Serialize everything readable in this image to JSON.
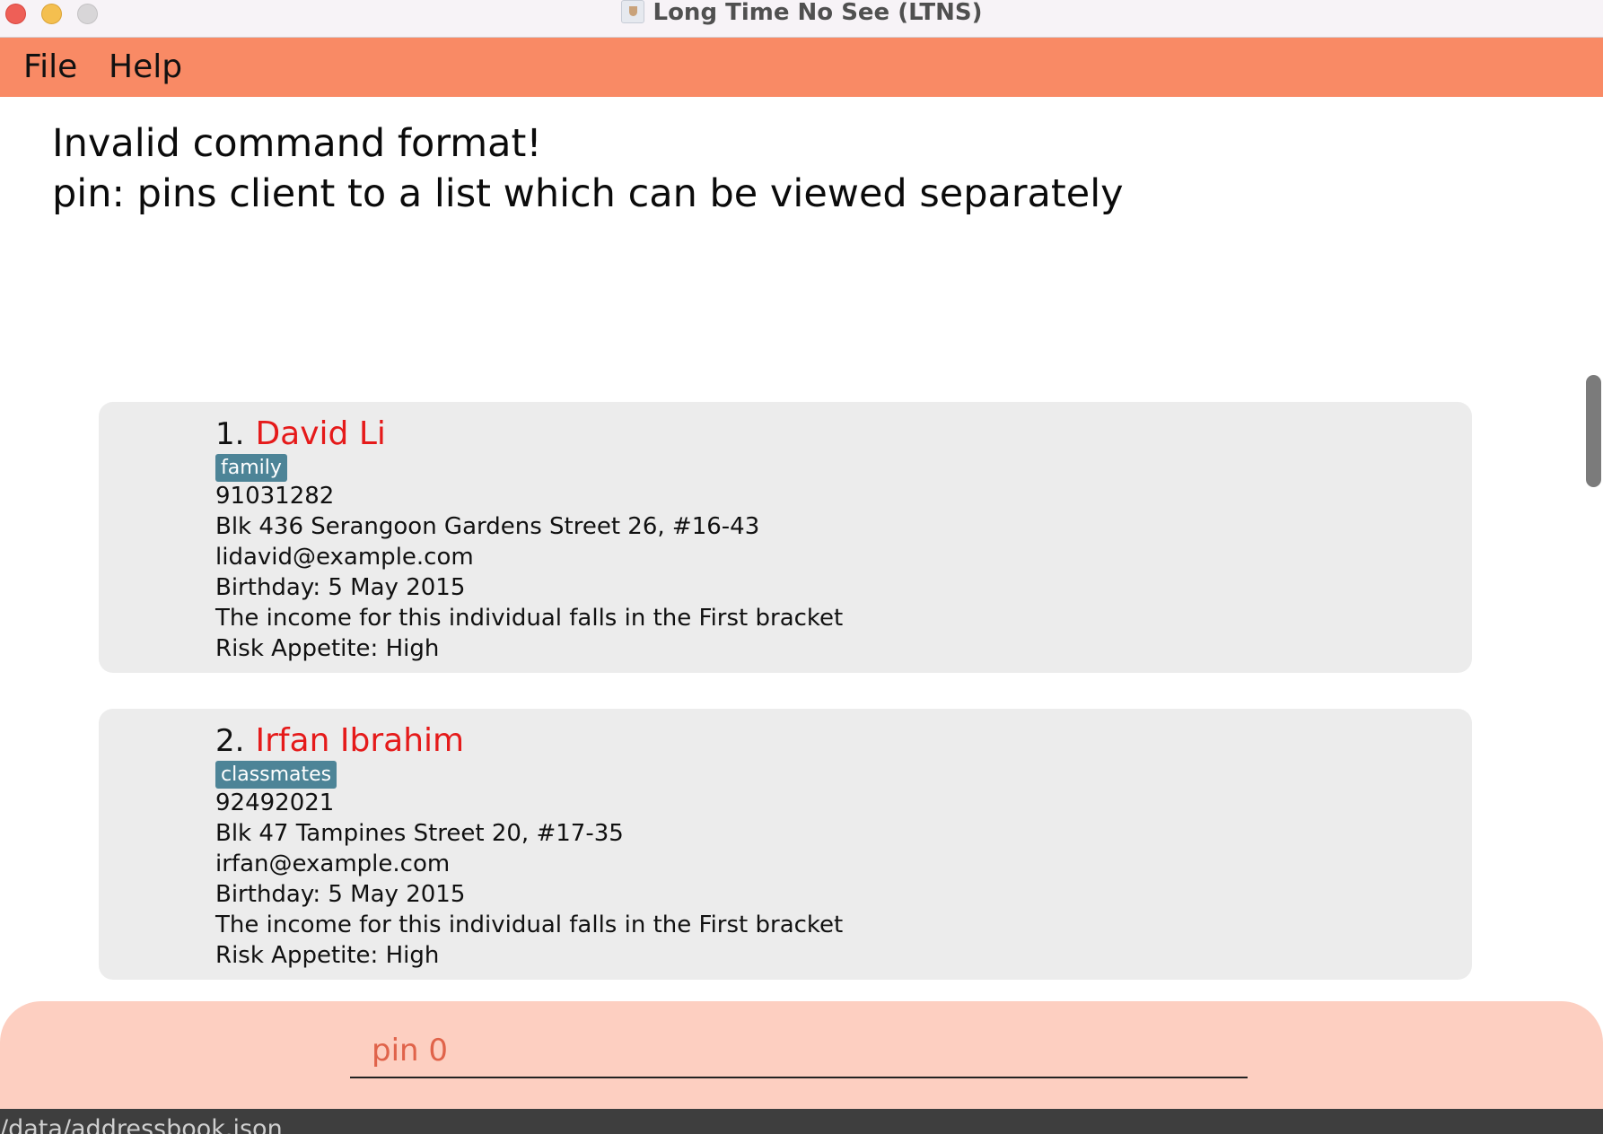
{
  "window": {
    "title": "Long Time No See (LTNS)"
  },
  "menu": {
    "file": "File",
    "help": "Help"
  },
  "result": {
    "line1": "Invalid command format!",
    "line2": "pin: pins client to a list which can be viewed separately"
  },
  "clients": [
    {
      "index": "1.",
      "name": "David Li",
      "tag": "family",
      "phone": "91031282",
      "address": "Blk 436 Serangoon Gardens Street 26, #16-43",
      "email": "lidavid@example.com",
      "birthday": "Birthday: 5 May 2015",
      "income": "The income for this individual falls in the First bracket",
      "risk": "Risk Appetite: High"
    },
    {
      "index": "2.",
      "name": "Irfan Ibrahim",
      "tag": "classmates",
      "phone": "92492021",
      "address": "Blk 47 Tampines Street 20, #17-35",
      "email": "irfan@example.com",
      "birthday": "Birthday: 5 May 2015",
      "income": "The income for this individual falls in the First bracket",
      "risk": "Risk Appetite: High"
    }
  ],
  "command": {
    "value": "pin 0"
  },
  "status": {
    "path": "/data/addressbook.json"
  },
  "colors": {
    "menubar": "#f98a65",
    "command_box": "#fdcfc1",
    "name": "#e51a1a",
    "tag": "#4d8497"
  },
  "icons": {
    "app": "app-icon"
  }
}
